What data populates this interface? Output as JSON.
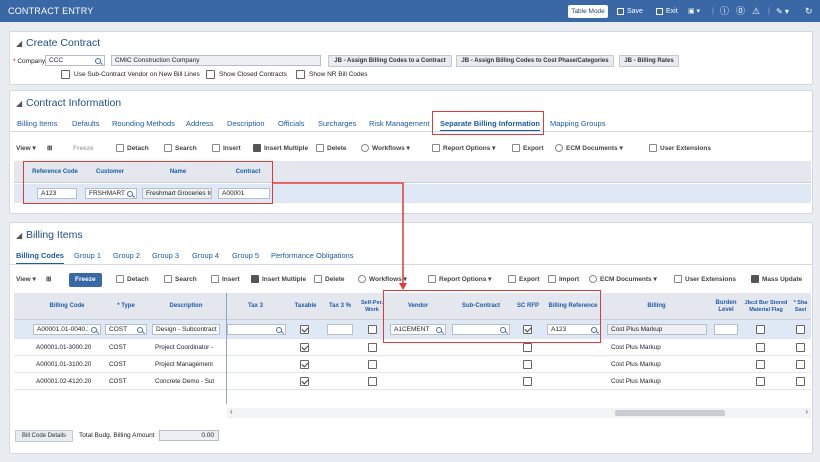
{
  "titlebar": {
    "title": "CONTRACT ENTRY",
    "table_mode": "Table Mode",
    "save": "Save",
    "exit": "Exit"
  },
  "create_contract": {
    "title": "Create Contract",
    "company_label": "Company",
    "company_value": "CCC",
    "company_name": "CMIC Construction Company",
    "btn_assign_billing_codes": "JB - Assign Billing Codes to a Contract",
    "btn_assign_cost_phase": "JB - Assign Billing Codes to Cost Phase/Categories",
    "btn_billing_rates": "JB - Billing Rates",
    "chk_sub_contract_vendor": "Use Sub-Contract Vendor on New Bill Lines",
    "chk_show_closed": "Show Closed Contracts",
    "chk_show_nr": "Show NR Bill Codes"
  },
  "contract_info": {
    "title": "Contract Information",
    "tabs": [
      "Billing Items",
      "Defaults",
      "Rounding Methods",
      "Address",
      "Description",
      "Officials",
      "Surcharges",
      "Risk Management",
      "Separate Billing Information",
      "Mapping Groups"
    ],
    "toolbar": [
      "View",
      "Freeze",
      "Detach",
      "Search",
      "Insert",
      "Insert Multiple",
      "Delete",
      "Workflows",
      "Report Options",
      "Export",
      "ECM Documents",
      "User Extensions"
    ],
    "columns": [
      "Reference Code",
      "Customer",
      "Name",
      "Contract"
    ],
    "row": {
      "reference_code": "A123",
      "customer": "FRSHMART",
      "name": "Freshmart Groceries Inc",
      "contract": "A00001"
    }
  },
  "billing_items": {
    "title": "Billing Items",
    "tabs": [
      "Billing Codes",
      "Group 1",
      "Group 2",
      "Group 3",
      "Group 4",
      "Group 5",
      "Performance Obligations"
    ],
    "toolbar": [
      "View",
      "Freeze",
      "Detach",
      "Search",
      "Insert",
      "Insert Multiple",
      "Delete",
      "Workflows",
      "Report Options",
      "Export",
      "Import",
      "ECM Documents",
      "User Extensions",
      "Mass Update"
    ],
    "columns": {
      "billing_code": "Billing Code",
      "type": "* Type",
      "description": "Description",
      "tax3": "Tax 3",
      "taxable": "Taxable",
      "tax3pct": "Tax 3 %",
      "self_perf": "Self-Per. Work",
      "vendor": "Vendor",
      "sub_contract": "Sub-Contract",
      "sc_rfp": "SC RFP",
      "billing_reference": "Billing Reference",
      "billing": "Billing",
      "burden_level": "Burden Level",
      "jbcd": "Jbcd Bur Stored Material Flag",
      "share": "* Sha Savi"
    },
    "rows": [
      {
        "code": "A00001.01-0040.:",
        "type": "COST",
        "description": "Design - Subcontract",
        "vendor": "A1CEMENT",
        "billing_reference": "A123",
        "billing": "Cost Plus Markup"
      },
      {
        "code": "A00001.01-3000.20",
        "type": "COST",
        "description": "Project Coordinator -",
        "vendor": "",
        "billing_reference": "",
        "billing": "Cost Plus Markup"
      },
      {
        "code": "A00001.01-3100.20",
        "type": "COST",
        "description": "Project Managemenl",
        "vendor": "",
        "billing_reference": "",
        "billing": "Cost Plus Markup"
      },
      {
        "code": "A00001.02-4120.20",
        "type": "COST",
        "description": "Concrete Demo - Sut",
        "vendor": "",
        "billing_reference": "",
        "billing": "Cost Plus Markup"
      }
    ],
    "footer": {
      "bill_code_details": "Bill Code Details",
      "total_label": "Total Budg. Billing Amount",
      "total_value": "0.00"
    }
  },
  "colors": {
    "header_blue": "#3a68a7",
    "link_blue": "#1f5aa6",
    "highlight_red": "#e03a3a",
    "selected_row": "#dfe8f5"
  }
}
